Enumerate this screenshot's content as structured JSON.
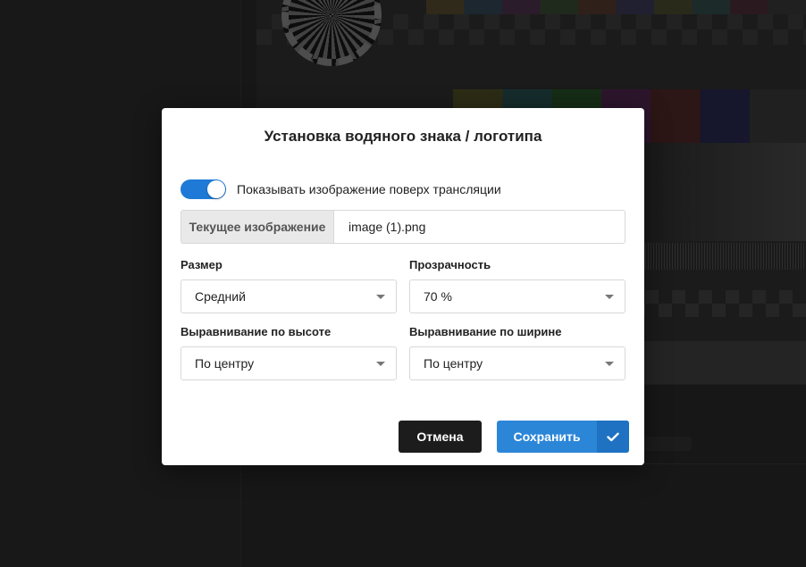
{
  "dialog": {
    "title": "Установка водяного знака / логотипа",
    "toggle": {
      "label": "Показывать изображение поверх трансляции",
      "checked": true
    },
    "current_image": {
      "label": "Текущее изображение",
      "value": "image (1).png"
    },
    "size": {
      "label": "Размер",
      "value": "Средний"
    },
    "opacity": {
      "label": "Прозрачность",
      "value": "70 %"
    },
    "vertical_align": {
      "label": "Выравнивание по высоте",
      "value": "По центру"
    },
    "horizontal_align": {
      "label": "Выравнивание по ширине",
      "value": "По центру"
    },
    "buttons": {
      "cancel": "Отмена",
      "save": "Сохранить"
    }
  },
  "colors": {
    "accent": "#2c86d8",
    "cancel": "#1c1c1c",
    "toggle_on": "#1e7ad6"
  },
  "icons": {
    "save_check": "check-icon",
    "select_caret": "caret-down-icon"
  }
}
